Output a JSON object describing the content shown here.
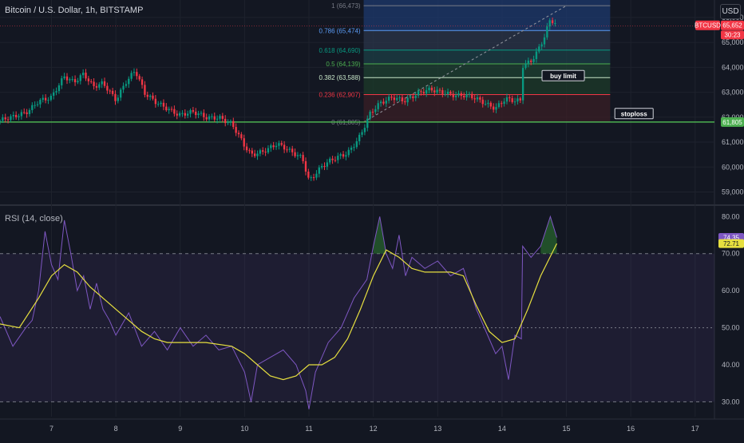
{
  "header": {
    "title": "Bitcoin / U.S. Dollar, 1h, BITSTAMP",
    "currency": "USD"
  },
  "rsi": {
    "title": "RSI (14, close)",
    "value_label": "74.35",
    "ma_label": "72.71",
    "ticks": [
      "80.00",
      "70.00",
      "60.00",
      "50.00",
      "40.00",
      "30.00"
    ]
  },
  "price_axis": {
    "ticks": [
      "66,000",
      "65,000",
      "64,000",
      "63,000",
      "62,000",
      "61,000",
      "60,000",
      "59,000"
    ],
    "symbol_tag": "BTCUSD",
    "last_price": "65,652",
    "countdown": "30:23",
    "hline_price": "61,805"
  },
  "time_axis": {
    "ticks": [
      "7",
      "8",
      "9",
      "10",
      "11",
      "12",
      "13",
      "14",
      "15",
      "16",
      "17"
    ]
  },
  "fib_levels": [
    {
      "ratio": "1",
      "price": "66,473",
      "color": "#787b86"
    },
    {
      "ratio": "0.786",
      "price": "65,474",
      "color": "#5b9cf6"
    },
    {
      "ratio": "0.618",
      "price": "64,690",
      "color": "#089981"
    },
    {
      "ratio": "0.5",
      "price": "64,139",
      "color": "#4caf50"
    },
    {
      "ratio": "0.382",
      "price": "63,588",
      "color": "#c8e6c9"
    },
    {
      "ratio": "0.236",
      "price": "62,907",
      "color": "#f23645"
    },
    {
      "ratio": "0",
      "price": "61,805",
      "color": "#787b86"
    }
  ],
  "annotations": {
    "buy_limit": "buy limit",
    "stoploss": "stoploss"
  },
  "colors": {
    "background": "#131722",
    "up": "#089981",
    "down": "#f23645",
    "hline": "#4caf50",
    "rsi_line": "#7e57c2",
    "rsi_ma": "#e6df3f"
  },
  "chart_data": {
    "type": "candlestick",
    "symbol": "BTCUSD",
    "interval": "1h",
    "ylim": [
      58600,
      66700
    ],
    "x_range_days": [
      6.2,
      17.3
    ],
    "price_path": [
      [
        6.2,
        61860
      ],
      [
        6.4,
        61950
      ],
      [
        6.6,
        62200
      ],
      [
        6.8,
        62700
      ],
      [
        7.0,
        62750
      ],
      [
        7.2,
        63600
      ],
      [
        7.35,
        63450
      ],
      [
        7.5,
        63800
      ],
      [
        7.65,
        63200
      ],
      [
        7.8,
        63300
      ],
      [
        8.0,
        62700
      ],
      [
        8.15,
        63450
      ],
      [
        8.3,
        63900
      ],
      [
        8.45,
        62900
      ],
      [
        8.6,
        62600
      ],
      [
        8.8,
        62400
      ],
      [
        9.0,
        62100
      ],
      [
        9.2,
        62150
      ],
      [
        9.4,
        62000
      ],
      [
        9.6,
        62050
      ],
      [
        9.8,
        61700
      ],
      [
        10.0,
        60800
      ],
      [
        10.1,
        60500
      ],
      [
        10.3,
        60700
      ],
      [
        10.5,
        60900
      ],
      [
        10.7,
        60600
      ],
      [
        10.9,
        60400
      ],
      [
        11.0,
        59500
      ],
      [
        11.2,
        60000
      ],
      [
        11.4,
        60300
      ],
      [
        11.6,
        60600
      ],
      [
        11.8,
        61300
      ],
      [
        11.95,
        62100
      ],
      [
        12.1,
        62500
      ],
      [
        12.3,
        62850
      ],
      [
        12.5,
        62700
      ],
      [
        12.7,
        62900
      ],
      [
        12.9,
        63100
      ],
      [
        13.1,
        63050
      ],
      [
        13.3,
        62850
      ],
      [
        13.5,
        62800
      ],
      [
        13.7,
        62650
      ],
      [
        13.9,
        62400
      ],
      [
        14.05,
        62700
      ],
      [
        14.2,
        62600
      ],
      [
        14.3,
        62650
      ],
      [
        14.32,
        64050
      ],
      [
        14.45,
        64300
      ],
      [
        14.55,
        64700
      ],
      [
        14.65,
        65200
      ],
      [
        14.75,
        65900
      ],
      [
        14.85,
        65650
      ]
    ],
    "fib_retracement": {
      "from": 61805,
      "to": 66473,
      "start_day": 11.85,
      "end_day": 15.68
    },
    "horizontal_line": 61805,
    "buy_limit_price": 63588,
    "stoploss_price": 61805,
    "rsi": {
      "period": 14,
      "ylim": [
        26,
        82
      ],
      "levels": [
        70,
        50,
        30
      ],
      "points": [
        [
          6.2,
          53
        ],
        [
          6.4,
          45
        ],
        [
          6.6,
          50
        ],
        [
          6.7,
          52
        ],
        [
          6.8,
          60
        ],
        [
          6.9,
          76
        ],
        [
          7.0,
          67
        ],
        [
          7.1,
          63
        ],
        [
          7.2,
          79
        ],
        [
          7.3,
          70
        ],
        [
          7.4,
          60
        ],
        [
          7.5,
          64
        ],
        [
          7.6,
          55
        ],
        [
          7.7,
          62
        ],
        [
          7.8,
          55
        ],
        [
          7.9,
          52
        ],
        [
          8.0,
          48
        ],
        [
          8.2,
          54
        ],
        [
          8.4,
          45
        ],
        [
          8.6,
          49
        ],
        [
          8.8,
          44
        ],
        [
          9.0,
          50
        ],
        [
          9.2,
          45
        ],
        [
          9.4,
          48
        ],
        [
          9.6,
          44
        ],
        [
          9.8,
          45
        ],
        [
          10.0,
          38
        ],
        [
          10.1,
          30
        ],
        [
          10.2,
          40
        ],
        [
          10.4,
          42
        ],
        [
          10.6,
          44
        ],
        [
          10.8,
          40
        ],
        [
          10.95,
          33
        ],
        [
          11.0,
          28
        ],
        [
          11.1,
          38
        ],
        [
          11.3,
          46
        ],
        [
          11.5,
          50
        ],
        [
          11.7,
          58
        ],
        [
          11.9,
          63
        ],
        [
          12.0,
          72
        ],
        [
          12.1,
          80
        ],
        [
          12.2,
          70
        ],
        [
          12.3,
          66
        ],
        [
          12.4,
          75
        ],
        [
          12.5,
          64
        ],
        [
          12.6,
          69
        ],
        [
          12.8,
          66
        ],
        [
          13.0,
          68
        ],
        [
          13.2,
          64
        ],
        [
          13.4,
          66
        ],
        [
          13.6,
          55
        ],
        [
          13.8,
          47
        ],
        [
          13.9,
          43
        ],
        [
          14.0,
          45
        ],
        [
          14.1,
          36
        ],
        [
          14.2,
          48
        ],
        [
          14.3,
          47
        ],
        [
          14.32,
          72
        ],
        [
          14.45,
          69
        ],
        [
          14.6,
          72
        ],
        [
          14.75,
          80
        ],
        [
          14.85,
          74.35
        ]
      ],
      "ma_points": [
        [
          6.2,
          51
        ],
        [
          6.5,
          50
        ],
        [
          6.8,
          58
        ],
        [
          7.0,
          64
        ],
        [
          7.2,
          67
        ],
        [
          7.4,
          65
        ],
        [
          7.6,
          61
        ],
        [
          7.8,
          58
        ],
        [
          8.0,
          55
        ],
        [
          8.2,
          52
        ],
        [
          8.4,
          49
        ],
        [
          8.6,
          47
        ],
        [
          8.8,
          46
        ],
        [
          9.0,
          46
        ],
        [
          9.4,
          46
        ],
        [
          9.8,
          45
        ],
        [
          10.0,
          43
        ],
        [
          10.2,
          40
        ],
        [
          10.4,
          37
        ],
        [
          10.6,
          36
        ],
        [
          10.8,
          37
        ],
        [
          11.0,
          40
        ],
        [
          11.2,
          40
        ],
        [
          11.4,
          42
        ],
        [
          11.6,
          47
        ],
        [
          11.8,
          55
        ],
        [
          12.0,
          64
        ],
        [
          12.2,
          71
        ],
        [
          12.4,
          69
        ],
        [
          12.6,
          66
        ],
        [
          12.8,
          65
        ],
        [
          13.0,
          65
        ],
        [
          13.2,
          65
        ],
        [
          13.4,
          64
        ],
        [
          13.6,
          56
        ],
        [
          13.8,
          49
        ],
        [
          14.0,
          46
        ],
        [
          14.2,
          47
        ],
        [
          14.4,
          55
        ],
        [
          14.6,
          64
        ],
        [
          14.85,
          72.71
        ]
      ]
    }
  }
}
